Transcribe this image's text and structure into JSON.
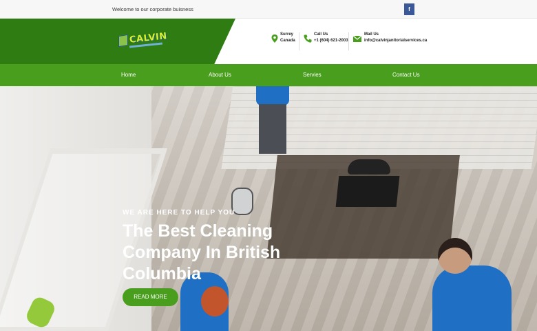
{
  "topbar": {
    "welcome": "Welcome to our corporate buisness",
    "facebook_label": "f"
  },
  "header": {
    "logo_text": "CALVIN",
    "location": {
      "line1": "Surrey",
      "line2": "Canada",
      "icon": "location-pin-icon"
    },
    "phone": {
      "line1": "Call Us",
      "line2": "+1 (604) 621-2003",
      "icon": "phone-icon"
    },
    "email": {
      "line1": "Mail Us",
      "line2": "info@calvinjanitorialservices.ca",
      "icon": "mail-icon"
    }
  },
  "nav": {
    "items": [
      {
        "label": "Home"
      },
      {
        "label": "About Us"
      },
      {
        "label": "Servies"
      },
      {
        "label": "Contact Us"
      }
    ]
  },
  "hero": {
    "eyebrow": "WE ARE HERE TO HELP YOU",
    "headline": "The Best Cleaning Company In British Columbia",
    "button": "READ MORE"
  },
  "colors": {
    "brand_green": "#4a9e1d",
    "dark_green": "#2f7d12",
    "facebook_blue": "#3b5998",
    "text_dark": "#222222"
  }
}
